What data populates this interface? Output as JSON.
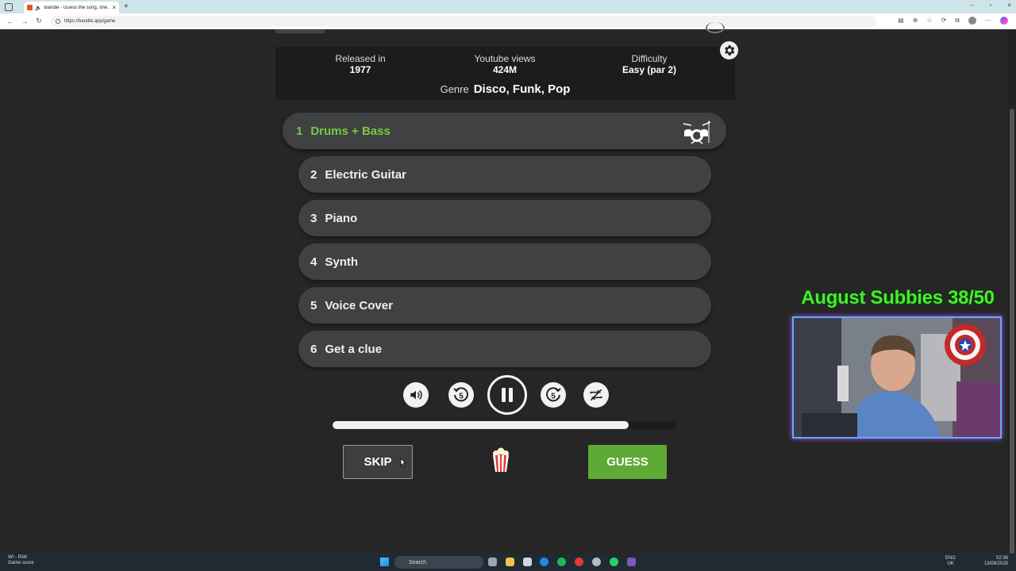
{
  "browser": {
    "tab_title": "Bandle - Guess the song, one...",
    "url": "https://bandle.app/game"
  },
  "info": {
    "released_label": "Released in",
    "released_value": "1977",
    "views_label": "Youtube views",
    "views_value": "424M",
    "difficulty_label": "Difficulty",
    "difficulty_value": "Easy (par 2)",
    "genre_label": "Genre",
    "genre_value": "Disco, Funk, Pop"
  },
  "stems": [
    {
      "num": "1",
      "label": "Drums + Bass",
      "active": true
    },
    {
      "num": "2",
      "label": "Electric Guitar"
    },
    {
      "num": "3",
      "label": "Piano"
    },
    {
      "num": "4",
      "label": "Synth"
    },
    {
      "num": "5",
      "label": "Voice Cover"
    },
    {
      "num": "6",
      "label": "Get a clue"
    }
  ],
  "controls": {
    "rewind_seconds": "5",
    "forward_seconds": "5",
    "progress_fraction": 0.86
  },
  "buttons": {
    "skip": "SKIP",
    "guess": "GUESS"
  },
  "overlay": {
    "title": "August Subbies 38/50"
  },
  "taskbar": {
    "weather_title": "WI - PAK",
    "weather_sub": "Game score",
    "search": "Search",
    "lang_top": "ENG",
    "lang_bottom": "UK",
    "time": "02:36",
    "date": "13/08/2025"
  },
  "colors": {
    "accent_green": "#7ac943",
    "guess_green": "#5faa35",
    "overlay_green": "#44ee2c",
    "background": "#262626"
  }
}
